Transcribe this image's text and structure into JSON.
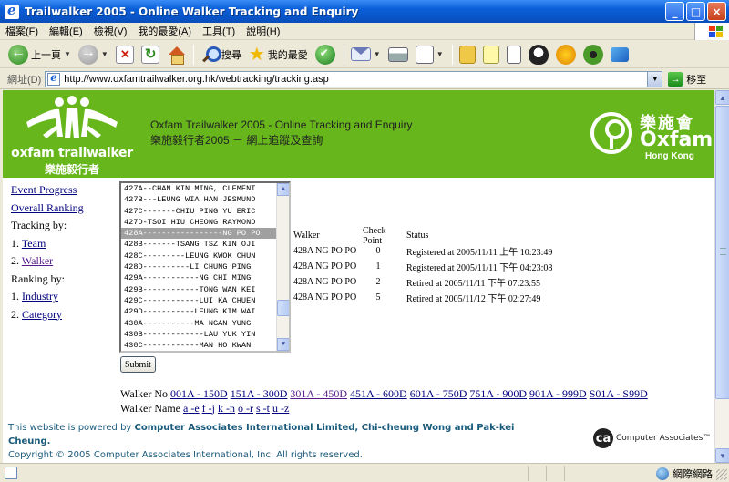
{
  "window": {
    "title": "Trailwalker 2005 - Online Walker Tracking and Enquiry",
    "buttons": [
      "_",
      "□",
      "×"
    ]
  },
  "menu": [
    "檔案(F)",
    "編輯(E)",
    "檢視(V)",
    "我的最愛(A)",
    "工具(T)",
    "說明(H)"
  ],
  "toolbar": {
    "back_label": "上一頁",
    "search_label": "搜尋",
    "favorites_label": "我的最愛"
  },
  "address": {
    "label": "網址(D)",
    "url": "http://www.oxfamtrailwalker.org.hk/webtracking/tracking.asp",
    "go_label": "移至"
  },
  "banner": {
    "logo_en": "oxfam trailwalker",
    "logo_zh": "樂施毅行者",
    "title": "Oxfam Trailwalker 2005 - Online Tracking and Enquiry",
    "title_zh": "樂施毅行者2005 － 網上追蹤及查詢",
    "oxfam_zh": "樂施會",
    "oxfam_en": "Oxfam",
    "oxfam_region": "Hong Kong",
    "colors": {
      "banner": "#67b71c"
    }
  },
  "nav": {
    "event_progress": "Event Progress",
    "overall_ranking": "Overall Ranking",
    "tracking_by": "Tracking by:",
    "team_num": "1.",
    "team": "Team",
    "walker_num": "2.",
    "walker": "Walker",
    "ranking_by": "Ranking by:",
    "industry_num": "1.",
    "industry": "Industry",
    "category_num": "2.",
    "category": "Category"
  },
  "walker_list": {
    "items": [
      "427A--CHAN KIN MING, CLEMENT",
      "427B---LEUNG WIA HAN JESMUND",
      "427C-------CHIU PING YU ERIC",
      "427D-TSOI HIU CHEONG RAYMOND",
      "428A-----------------NG PO PO",
      "428B-------TSANG TSZ KIN OJI",
      "428C---------LEUNG KWOK CHUN",
      "428D----------LI CHUNG PING",
      "429A------------NG CHI MING",
      "429B------------TONG WAN KEI",
      "429C------------LUI KA CHUEN",
      "429D-----------LEUNG KIM WAI",
      "430A-----------MA NGAN YUNG",
      "430B-------------LAU YUK YIN",
      "430C------------MAN HO KWAN"
    ],
    "selected_index": 4,
    "submit_label": "Submit"
  },
  "results": {
    "headers": {
      "walker": "Walker",
      "checkpoint": "Check Point",
      "status": "Status"
    },
    "rows": [
      {
        "walker": "428A NG PO PO",
        "checkpoint": "0",
        "status": "Registered at 2005/11/11 上午 10:23:49"
      },
      {
        "walker": "428A NG PO PO",
        "checkpoint": "1",
        "status": "Registered at 2005/11/11 下午 04:23:08"
      },
      {
        "walker": "428A NG PO PO",
        "checkpoint": "2",
        "status": "Retired at 2005/11/11 下午 07:23:55"
      },
      {
        "walker": "428A NG PO PO",
        "checkpoint": "5",
        "status": "Retired at 2005/11/12 下午 02:27:49"
      }
    ]
  },
  "walker_no": {
    "label": "Walker No",
    "ranges": [
      "001A - 150D",
      "151A - 300D",
      "301A - 450D",
      "451A - 600D",
      "601A - 750D",
      "751A - 900D",
      "901A - 999D",
      "S01A - S99D"
    ]
  },
  "walker_name": {
    "label": "Walker Name",
    "ranges": [
      "a",
      "e",
      "f",
      "j",
      "k",
      "n",
      "o",
      "r",
      "s",
      "t",
      "u",
      "z"
    ]
  },
  "footer": {
    "powered_prefix": "This website is powered by ",
    "powered_by": "Computer Associates International Limited, Chi-cheung Wong and Pak-kei Cheung.",
    "copyright": "Copyright © 2005 Computer Associates International, Inc. All rights reserved.",
    "ca_mark": "ca",
    "ca_name": "Computer Associates™"
  },
  "statusbar": {
    "zone": "網際網路"
  }
}
